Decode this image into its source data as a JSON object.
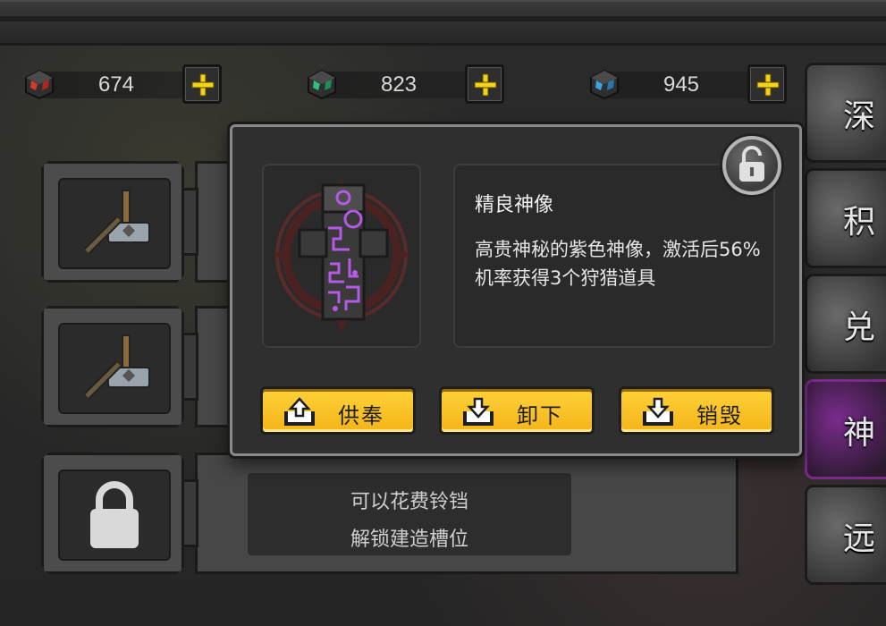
{
  "resources": [
    {
      "icon": "red-gem-icon",
      "value": "674"
    },
    {
      "icon": "green-gem-icon",
      "value": "823"
    },
    {
      "icon": "blue-gem-icon",
      "value": "945"
    }
  ],
  "slots": {
    "locked_text_line1": "可以花费铃铛",
    "locked_text_line2": "解锁建造槽位"
  },
  "side_tabs": [
    {
      "label": "深"
    },
    {
      "label": "积"
    },
    {
      "label": "兑"
    },
    {
      "label": "神"
    },
    {
      "label": "远"
    }
  ],
  "popup": {
    "item_name": "精良神像",
    "item_desc": "高贵神秘的紫色神像，激活后56%机率获得3个狩猎道具",
    "buttons": {
      "offer": "供奉",
      "unequip": "卸下",
      "destroy": "销毁"
    }
  },
  "colors": {
    "button_yellow": "#ffd23a",
    "totem_purple": "#b45ae6",
    "accent_plus": "#f2d21b"
  }
}
